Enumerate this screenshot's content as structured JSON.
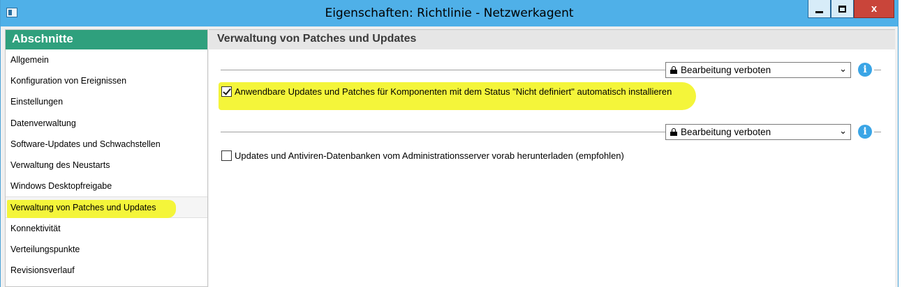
{
  "window": {
    "title": "Eigenschaften: Richtlinie - Netzwerkagent",
    "close_label": "x"
  },
  "sidebar": {
    "header": "Abschnitte",
    "items": [
      {
        "label": "Allgemein"
      },
      {
        "label": "Konfiguration von Ereignissen"
      },
      {
        "label": "Einstellungen"
      },
      {
        "label": "Datenverwaltung"
      },
      {
        "label": "Software-Updates und Schwachstellen"
      },
      {
        "label": "Verwaltung des Neustarts"
      },
      {
        "label": "Windows Desktopfreigabe"
      },
      {
        "label": "Verwaltung von Patches und Updates"
      },
      {
        "label": "Konnektivität"
      },
      {
        "label": "Verteilungspunkte"
      },
      {
        "label": "Revisionsverlauf"
      }
    ],
    "selected_index": 7
  },
  "main": {
    "header": "Verwaltung von Patches und Updates",
    "groups": [
      {
        "lock_select": "Bearbeitung verboten",
        "checkbox_label": "Anwendbare Updates und Patches für Komponenten mit dem Status \"Nicht definiert\" automatisch installieren",
        "checked": true
      },
      {
        "lock_select": "Bearbeitung verboten",
        "checkbox_label": "Updates und Antiviren-Datenbanken vom Administrationsserver vorab herunterladen (empfohlen)",
        "checked": false
      }
    ]
  },
  "colors": {
    "titlebar": "#4fb0e8",
    "sidebar_header": "#2fa07d",
    "highlight": "#f4f53a",
    "info": "#3aa5e6"
  },
  "icons": [
    "app-icon",
    "minimize-icon",
    "maximize-icon",
    "close-icon",
    "lock-icon",
    "chevron-down-icon",
    "info-icon",
    "checkmark-icon"
  ]
}
